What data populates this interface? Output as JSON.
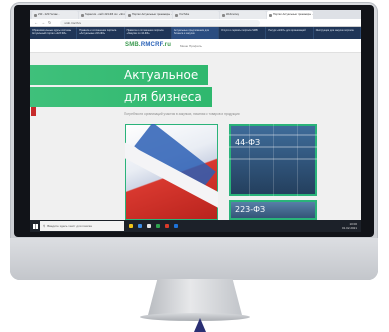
{
  "browser": {
    "tabs": [
      {
        "label": "233 - 223 Госзак..."
      },
      {
        "label": "Гарантия - сайт 223-ФЗ гос. «Это ..."
      },
      {
        "label": "Портал Актуальные тренажеры ..."
      },
      {
        "label": "YouTube"
      },
      {
        "label": "Webmoney"
      },
      {
        "label": "Портал Актуальные тренажеры ..."
      }
    ],
    "active_tab": 5,
    "url": "smb.rmcrf.ru"
  },
  "site_nav": {
    "items": [
      {
        "label": "Образовательные курсы системы Актуальный портал «223 ФЗ»"
      },
      {
        "label": "Правила и соглашение портала «Актуальные 223-ФЗ»"
      },
      {
        "label": "Правила и соглашения портала «Закупки по 44-ФЗ»"
      },
      {
        "label": "Актуальные предложения для бизнеса и закупок"
      },
      {
        "label": "Услуги и сервисы портала SMB"
      },
      {
        "label": "Ресурс «ЖКХ» для организаций"
      },
      {
        "label": "Инструкция для закупок портала"
      }
    ],
    "active_index": 3
  },
  "site_header": {
    "logo_left": "SMB.",
    "logo_mid": "RMCRF",
    "logo_right": ".ru",
    "links": "Меню   Профиль"
  },
  "hero": {
    "line1": "Актуальное",
    "line2": "для бизнеса",
    "tagline": "Потребности организаций участия в закупках, начиная с товаров и продукции",
    "card_44_label": "44-ФЗ",
    "card_223_label": "223-ФЗ"
  },
  "taskbar": {
    "search_placeholder": "Введите здесь текст для поиска",
    "time": "10:00",
    "date": "01.02.2021",
    "icon_colors": [
      "#f0c419",
      "#3d8ee8",
      "#e5e5e5",
      "#2fa34f",
      "#d93a2a",
      "#1e73d8"
    ]
  },
  "colors": {
    "accent_green": "#2fb86e",
    "nav_blue": "#1f3557",
    "logo_green": "#3b9a4f",
    "logo_blue": "#2b63b8"
  }
}
